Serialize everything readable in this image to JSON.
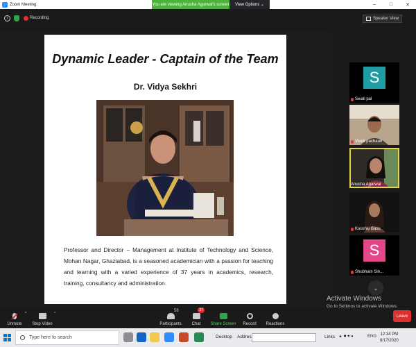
{
  "window": {
    "title": "Zoom Meeting"
  },
  "banner": {
    "message": "You are viewing Anusha Agarwal's screen",
    "view_options": "View Options ⌄"
  },
  "window_controls": {
    "minimize": "–",
    "maximize": "□",
    "close": "✕"
  },
  "meeting": {
    "info_glyph": "i",
    "recording_label": "Recording",
    "speaker_view_label": "Speaker View"
  },
  "slide": {
    "heading": "Dynamic Leader - Captain of the Team",
    "name": "Dr. Vidya Sekhri",
    "bio": "Professor and Director – Management at Institute of Technology and Science, Mohan Nagar, Ghaziabad, is a seasoned academician with a passion for teaching and learning with a varied experience of 37 years in academics, research, training, consultancy and administration."
  },
  "participants": [
    {
      "name": "Swati pal",
      "initial": "S",
      "kind": "avatar",
      "color": "#1f9ba3"
    },
    {
      "name": "Vivek pachauri",
      "kind": "video"
    },
    {
      "name": "Anusha Agarwal",
      "kind": "video",
      "active": true
    },
    {
      "name": "Koushki Basu",
      "kind": "video"
    },
    {
      "name": "Shubham Sin...",
      "initial": "S",
      "kind": "avatar",
      "color": "#e24789"
    }
  ],
  "toolbar": {
    "unmute": "Unmute",
    "stop_video": "Stop Video",
    "participants": "Participants",
    "participants_count": "58",
    "chat": "Chat",
    "chat_badge": "37",
    "share_screen": "Share Screen",
    "record": "Record",
    "reactions": "Reactions",
    "leave": "Leave",
    "caret": "^"
  },
  "watermark": {
    "line1": "Activate Windows",
    "line2": "Go to Settings to activate Windows."
  },
  "taskbar": {
    "search_placeholder": "Type here to search",
    "desktop_label": "Desktop",
    "address_label": "Address",
    "links_label": "Links",
    "time": "12:34 PM",
    "date": "8/17/2020",
    "language": "ENG"
  },
  "chev_glyph": "⌄"
}
